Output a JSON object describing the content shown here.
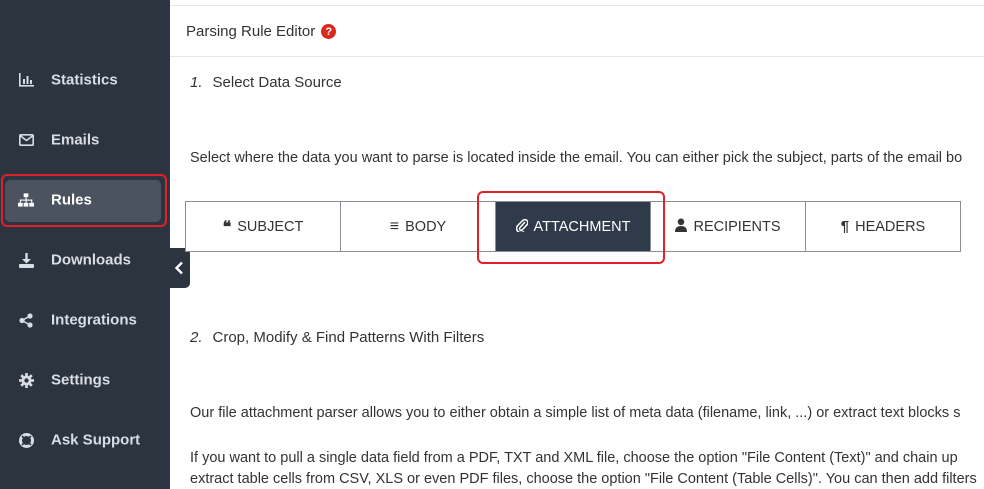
{
  "sidebar": {
    "items": [
      {
        "label": "Statistics",
        "icon": "bar-chart-icon"
      },
      {
        "label": "Emails",
        "icon": "envelope-icon"
      },
      {
        "label": "Rules",
        "icon": "sitemap-icon",
        "active": true
      },
      {
        "label": "Downloads",
        "icon": "download-icon"
      },
      {
        "label": "Integrations",
        "icon": "share-icon"
      },
      {
        "label": "Settings",
        "icon": "gear-icon"
      },
      {
        "label": "Ask Support",
        "icon": "lifebuoy-icon"
      }
    ]
  },
  "header": {
    "title": "Parsing Rule Editor",
    "help_glyph": "?"
  },
  "step1": {
    "number": "1.",
    "label": "Select Data Source",
    "description": "Select where the data you want to parse is located inside the email. You can either pick the subject, parts of the email bo"
  },
  "source_tabs": [
    {
      "label": "SUBJECT",
      "icon": "quote-icon",
      "glyph": "❝"
    },
    {
      "label": "BODY",
      "icon": "align-left-icon",
      "glyph": "≡"
    },
    {
      "label": "ATTACHMENT",
      "icon": "paperclip-icon",
      "glyph": "📎",
      "active": true
    },
    {
      "label": "RECIPIENTS",
      "icon": "user-icon",
      "glyph": "●"
    },
    {
      "label": "HEADERS",
      "icon": "paragraph-icon",
      "glyph": "¶"
    }
  ],
  "step2": {
    "number": "2.",
    "label": "Crop, Modify & Find Patterns With Filters",
    "para1": "Our file attachment parser allows you to either obtain a simple list of meta data (filename, link, ...) or extract text blocks s",
    "para2_line1": "If you want to pull a single data field from a PDF, TXT and XML file, choose the option \"File Content (Text)\" and chain up",
    "para2_line2": "extract table cells from CSV, XLS or even PDF files, choose the option \"File Content (Table Cells)\". You can then add filters"
  },
  "colors": {
    "sidebar_bg": "#2c3440",
    "active_tab_bg": "#2f3b4b",
    "highlight": "#e0212a",
    "help_icon": "#d9281e"
  }
}
